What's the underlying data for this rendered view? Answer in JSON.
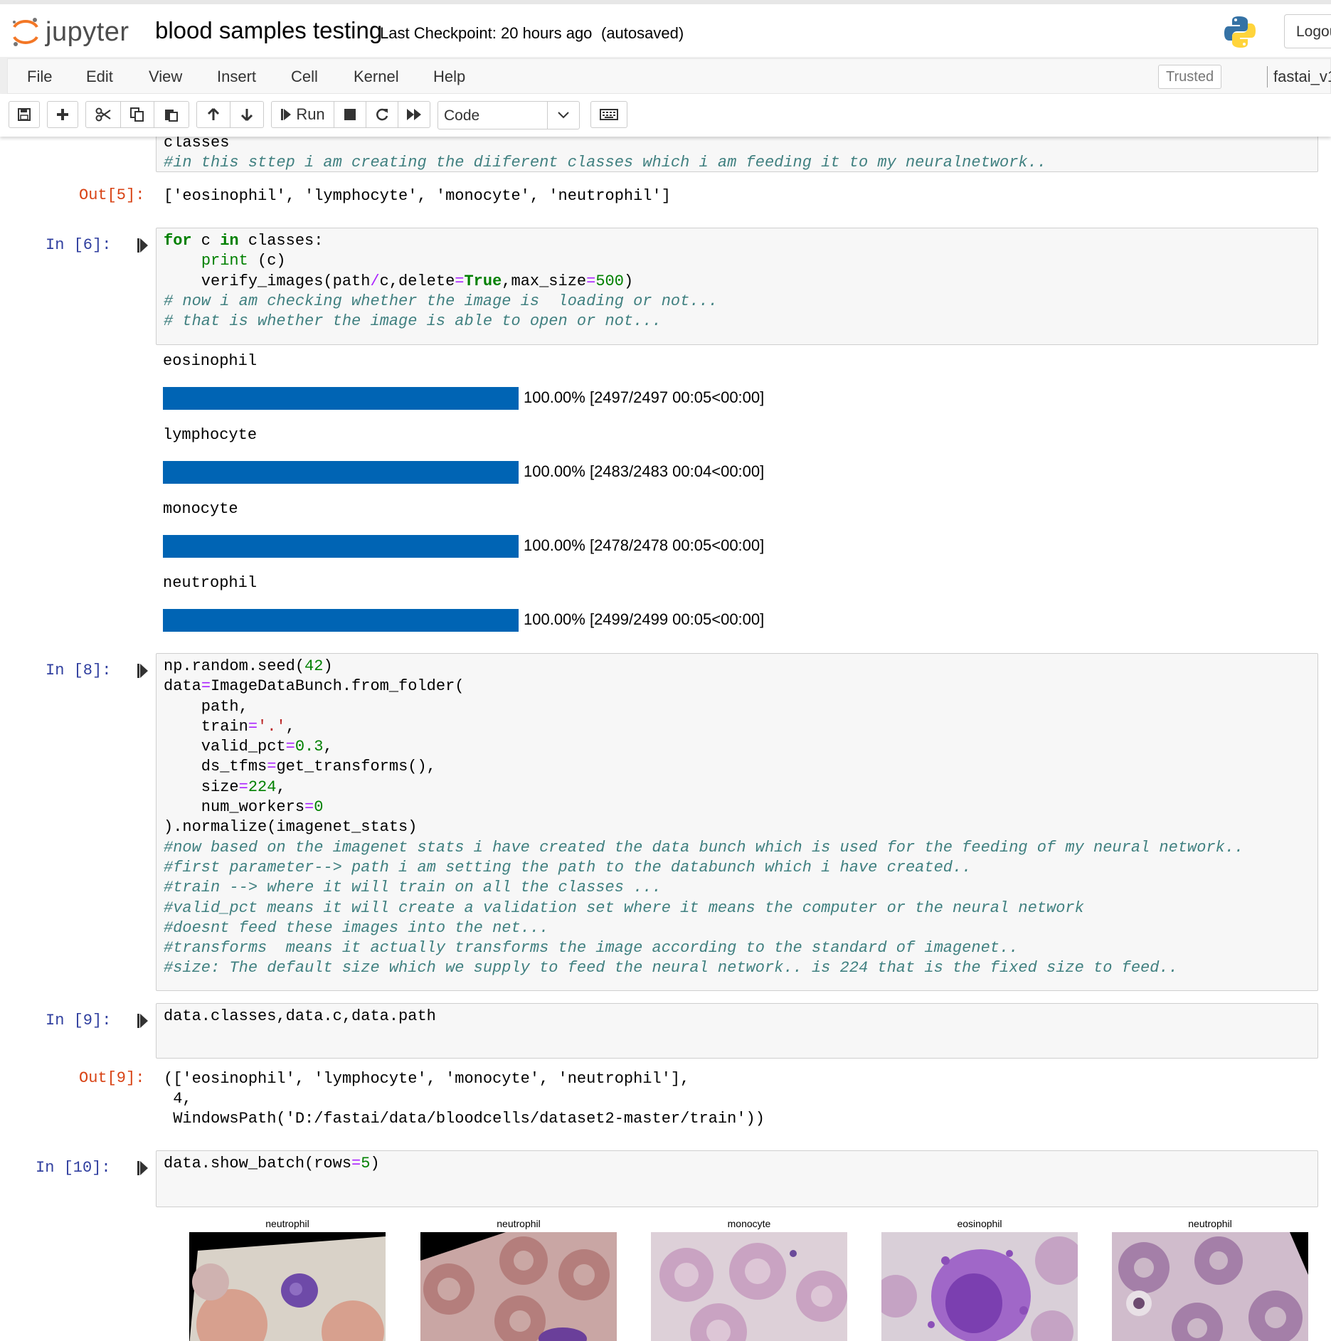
{
  "header": {
    "logo_text": "jupyter",
    "notebook_title": "blood samples testing",
    "checkpoint": "Last Checkpoint: 20 hours ago",
    "autosave": "(autosaved)",
    "logout_label": "Logou"
  },
  "menu": {
    "items": [
      "File",
      "Edit",
      "View",
      "Insert",
      "Cell",
      "Kernel",
      "Help"
    ],
    "trusted_label": "Trusted",
    "kernel_name": "fastai_v1"
  },
  "toolbar": {
    "run_label": "Run",
    "cell_type": "Code"
  },
  "cells": {
    "c5_tail_line1": "classes",
    "c5_tail_line2": "#in this sttep i am creating the diiferent classes which i am feeding it to my neuralnetwork..",
    "out5_prompt": "Out[5]:",
    "out5_text": "['eosinophil', 'lymphocyte', 'monocyte', 'neutrophil']",
    "in6_prompt": "In [6]:",
    "in6_comment1": "# now i am checking whether the image is  loading or not...",
    "in6_comment2": "# that is whether the image is able to open or not...",
    "progress": [
      {
        "label": "eosinophil",
        "percent": 100,
        "status": "100.00% [2497/2497 00:05<00:00]"
      },
      {
        "label": "lymphocyte",
        "percent": 100,
        "status": "100.00% [2483/2483 00:04<00:00]"
      },
      {
        "label": "monocyte",
        "percent": 100,
        "status": "100.00% [2478/2478 00:05<00:00]"
      },
      {
        "label": "neutrophil",
        "percent": 100,
        "status": "100.00% [2499/2499 00:05<00:00]"
      }
    ],
    "in8_prompt": "In [8]:",
    "in8_comments": [
      "#now based on the imagenet stats i have created the data bunch which is used for the feeding of my neural network..",
      "#first parameter--> path i am setting the path to the databunch which i have created..",
      "#train --> where it will train on all the classes ...",
      "#valid_pct means it will create a validation set where it means the computer or the neural network",
      "#doesnt feed these images into the net...",
      "#transforms  means it actually transforms the image according to the standard of imagenet..",
      "#size: The default size which we supply to feed the neural network.. is 224 that is the fixed size to feed.."
    ],
    "in9_prompt": "In [9]:",
    "in9_code": "data.classes,data.c,data.path",
    "out9_prompt": "Out[9]:",
    "out9_line1": "(['eosinophil', 'lymphocyte', 'monocyte', 'neutrophil'],",
    "out9_line2": " 4,",
    "out9_line3": " WindowsPath('D:/fastai/data/bloodcells/dataset2-master/train'))",
    "in10_prompt": "In [10]:",
    "batch_labels": [
      "neutrophil",
      "neutrophil",
      "monocyte",
      "eosinophil",
      "neutrophil"
    ]
  },
  "colors": {
    "progress_bar": "#0064b4",
    "prompt_in": "#303f9f",
    "prompt_out": "#d84315"
  }
}
